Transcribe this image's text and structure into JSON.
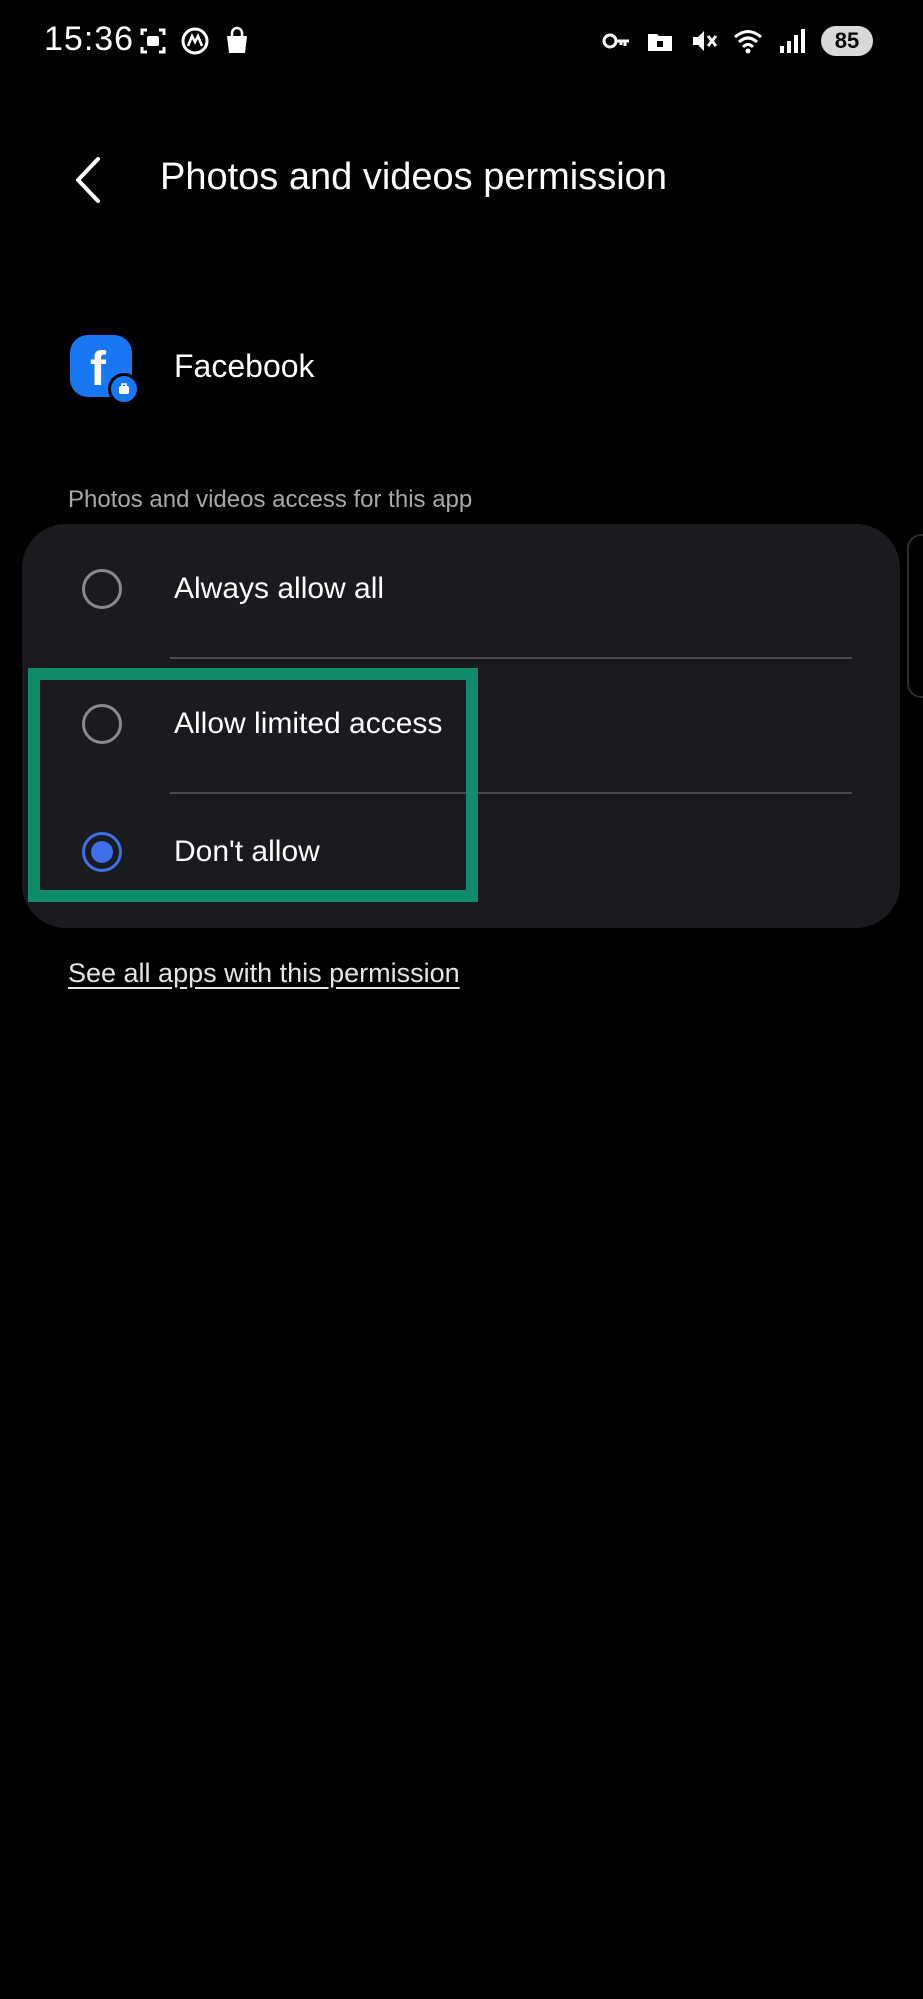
{
  "status_bar": {
    "time": "15:36",
    "battery": "85",
    "left_icons": [
      "screenshot-icon",
      "assistant-icon",
      "shopping-bag-icon"
    ],
    "right_icons": [
      "key-icon",
      "folder-lock-icon",
      "mute-icon",
      "wifi-icon",
      "signal-icon"
    ]
  },
  "header": {
    "title": "Photos and videos permission"
  },
  "app": {
    "name": "Facebook",
    "icon": "facebook-icon",
    "icon_letter": "f"
  },
  "section": {
    "label": "Photos and videos access for this app"
  },
  "options": [
    {
      "label": "Always allow all",
      "selected": false
    },
    {
      "label": "Allow limited access",
      "selected": false
    },
    {
      "label": "Don't allow",
      "selected": true
    }
  ],
  "link": {
    "label": "See all apps with this permission"
  },
  "colors": {
    "background": "#000000",
    "card": "#1a1b1e",
    "accent": "#3e6ee8",
    "highlight": "#0f8c6a",
    "facebook_blue": "#1877f2"
  }
}
